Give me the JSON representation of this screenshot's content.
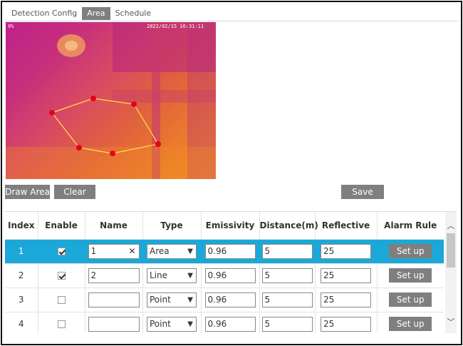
{
  "tabs": [
    {
      "label": "Detection Config",
      "active": false
    },
    {
      "label": "Area",
      "active": true
    },
    {
      "label": "Schedule",
      "active": false
    }
  ],
  "video": {
    "osd_left": "0%",
    "osd_timestamp": "2022/02/15 16:31:11",
    "polygon_points_count": 7
  },
  "buttons": {
    "draw_area": "Draw Area",
    "clear": "Clear",
    "save": "Save",
    "setup": "Set up"
  },
  "table": {
    "headers": [
      "Index",
      "Enable",
      "Name",
      "Type",
      "Emissivity",
      "Distance(m)",
      "Reflective",
      "Alarm Rule"
    ],
    "rows": [
      {
        "index": "1",
        "enabled": true,
        "name": "1",
        "type": "Area",
        "emissivity": "0.96",
        "distance": "5",
        "reflective": "25",
        "selected": true
      },
      {
        "index": "2",
        "enabled": true,
        "name": "2",
        "type": "Line",
        "emissivity": "0.96",
        "distance": "5",
        "reflective": "25",
        "selected": false
      },
      {
        "index": "3",
        "enabled": false,
        "name": "",
        "type": "Point",
        "emissivity": "0.96",
        "distance": "5",
        "reflective": "25",
        "selected": false
      },
      {
        "index": "4",
        "enabled": false,
        "name": "",
        "type": "Point",
        "emissivity": "0.96",
        "distance": "5",
        "reflective": "25",
        "selected": false
      }
    ]
  },
  "colors": {
    "accent_selected_row": "#1ba8d8",
    "button_gray": "#7f7f7f",
    "polygon_line": "#ffe24a",
    "polygon_point": "#e8001c"
  },
  "icons": {
    "clear_input": "close-icon",
    "dropdown": "chevron-down-icon",
    "scroll_up": "chevron-up-icon",
    "scroll_down": "chevron-down-icon"
  }
}
